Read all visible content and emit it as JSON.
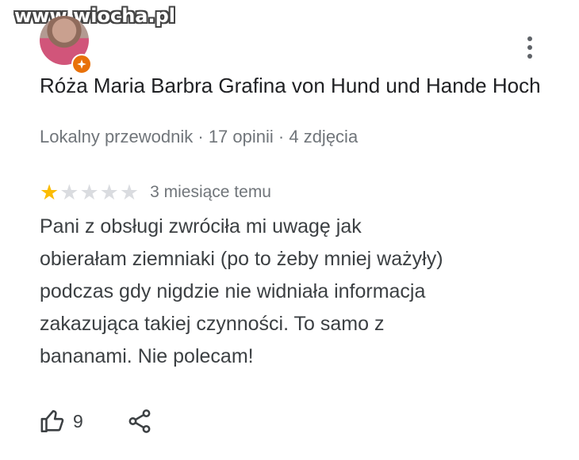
{
  "watermark": {
    "text": "www.wiocha.pl"
  },
  "reviewer": {
    "name": "Róża Maria Barbra Grafina von Hund und Hande Hoch",
    "badge": "Lokalny przewodnik",
    "review_count": "17 opinii",
    "photo_count": "4 zdjęcia",
    "separator": "·",
    "avatar_icon": "user-avatar",
    "badge_icon": "local-guide-star-icon"
  },
  "review": {
    "rating": 1,
    "rating_max": 5,
    "time": "3 miesiące temu",
    "text_lines": [
      "Pani z obsługi zwróciła mi uwagę jak",
      "obierałam ziemniaki (po to żeby mniej ważyły)",
      "podczas gdy nigdzie nie widniała informacja",
      "zakazująca takiej czynności. To samo z",
      "bananami. Nie polecam!"
    ]
  },
  "actions": {
    "like_count": "9",
    "like_icon": "thumb-up-icon",
    "share_icon": "share-icon",
    "more_icon": "more-vert-icon"
  },
  "colors": {
    "star_on": "#fbbc04",
    "star_off": "#dadce0",
    "badge": "#e8710a",
    "secondary_text": "#70757a"
  }
}
